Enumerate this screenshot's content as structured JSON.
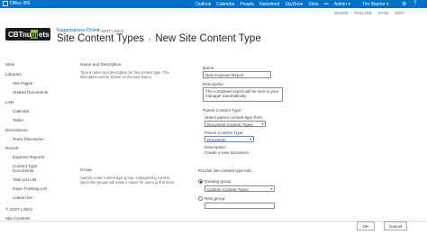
{
  "suitebar": {
    "brand": "Office 365",
    "nav": [
      "Outlook",
      "Calendar",
      "People",
      "Newsfeed",
      "SkyDrive",
      "Sites",
      "•••",
      "Admin ▾"
    ],
    "user": "Tim Warner ▾",
    "settings_icon": "gear-icon",
    "help_icon": "question-icon",
    "brand_color": "#0072c6"
  },
  "sharebar": {
    "actions": [
      "SHARE",
      "FOLLOW",
      "SYNC",
      "EDIT"
    ]
  },
  "header": {
    "logo_text": "CBT nuggets",
    "site_link": "Nuggetsphere Online",
    "edit_links": "EDIT LINKS",
    "breadcrumb_1": "Site Content Types",
    "breadcrumb_sep": "›",
    "breadcrumb_2": "New Site Content Type"
  },
  "leftnav": {
    "items": [
      "Sites",
      "Libraries",
      "Site Pages",
      "Shared Documents",
      "Lists",
      "Calendar",
      "Tasks",
      "Discussions",
      "Team Discussion",
      "Recent",
      "Expense Reports",
      "Content Type",
      "Documents",
      "Task List List",
      "Issue Tracking List",
      "custom list"
    ],
    "edit_links": "EDIT LINKS",
    "site_contents": "Site Contents"
  },
  "form": {
    "name_section_title": "Name and Description",
    "name_section_desc": "Type a name and description for this content type. The description will be shown on the new button.",
    "name_label": "Name:",
    "name_value": "New Expense Report",
    "description_label": "Description:",
    "description_value": "The completed report will be sent to your manager automatically.",
    "parent_label": "Parent Content Type:",
    "parent_group_label": "Select parent content type from:",
    "parent_group_value": "Document Content Types",
    "parent_type_label": "Parent Content Type:",
    "parent_type_value": "Document",
    "parent_desc_label": "Description:",
    "parent_desc_value": "Create a new document.",
    "group_section_title": "Group",
    "group_section_desc": "Specify a site content type group. Categorizing content types into groups will make it easier for users to find them.",
    "put_into_label": "Put this site content type into:",
    "existing_group_label": "Existing group:",
    "existing_group_value": "Custom Content Types",
    "new_group_label": "New group:",
    "ok_label": "OK",
    "cancel_label": "Cancel"
  }
}
